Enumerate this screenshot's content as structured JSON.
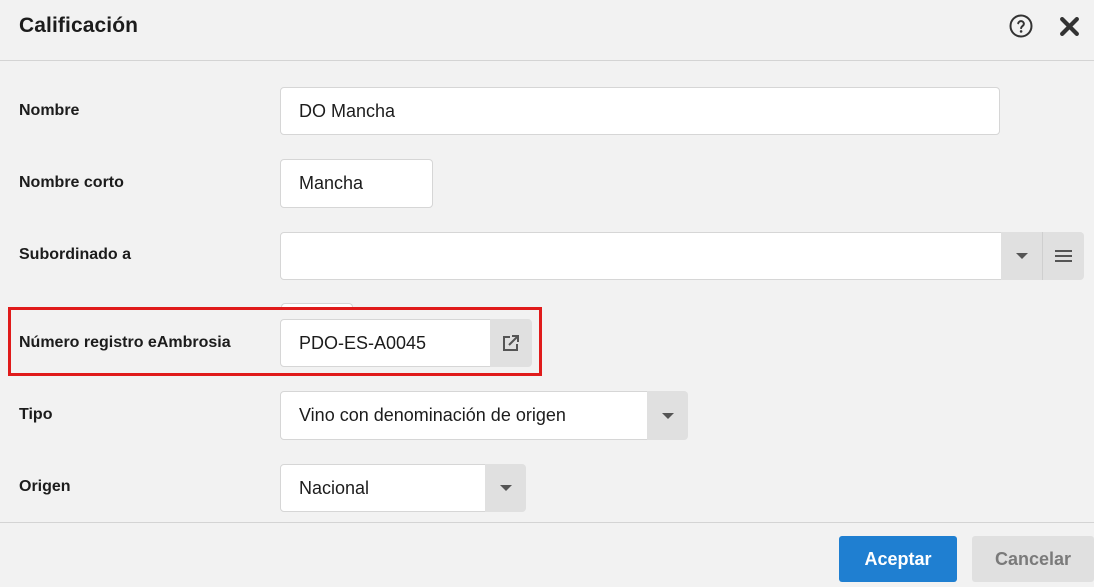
{
  "dialog": {
    "title": "Calificación",
    "help_icon": "help-circle-icon",
    "close_icon": "close-icon"
  },
  "fields": {
    "nombre": {
      "label": "Nombre",
      "value": "DO Mancha"
    },
    "nombre_corto": {
      "label": "Nombre corto",
      "value": "Mancha"
    },
    "subordinado": {
      "label": "Subordinado a",
      "value": ""
    },
    "registro": {
      "label": "Número registro eAmbrosia",
      "value": "PDO-ES-A0045",
      "icon": "external-link-icon"
    },
    "tipo": {
      "label": "Tipo",
      "value": "Vino con denominación de origen"
    },
    "origen": {
      "label": "Origen",
      "value": "Nacional"
    }
  },
  "footer": {
    "accept_label": "Aceptar",
    "cancel_label": "Cancelar"
  },
  "colors": {
    "primary": "#1f7fd1",
    "highlight": "#e01b1b"
  }
}
